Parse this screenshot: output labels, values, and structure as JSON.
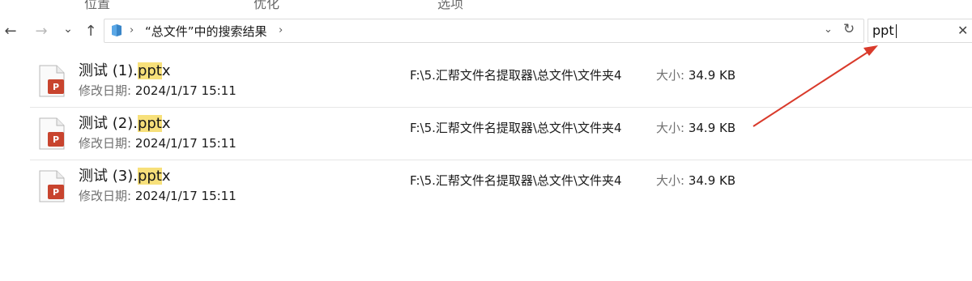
{
  "ribbon": {
    "tabs": [
      "位置",
      "优化",
      "选项"
    ]
  },
  "nav": {
    "back_icon": "←",
    "forward_icon": "→",
    "recent_icon": "⌄",
    "up_icon": "↑"
  },
  "address": {
    "separator": "›",
    "breadcrumb": "“总文件”中的搜索结果",
    "dropdown_icon": "⌄",
    "refresh_icon": "↻"
  },
  "search": {
    "value": "ppt",
    "clear_icon": "✕"
  },
  "colors": {
    "highlight": "#f7e07a",
    "annotation_arrow": "#d93a2b",
    "ppt_red": "#c8442e"
  },
  "results": [
    {
      "name_prefix": "测试 (1).",
      "name_match": "ppt",
      "name_suffix": "x",
      "modified_label": "修改日期:",
      "modified_value": "2024/1/17 15:11",
      "path": "F:\\5.汇帮文件名提取器\\总文件\\文件夹4",
      "size_label": "大小:",
      "size_value": "34.9 KB"
    },
    {
      "name_prefix": "测试 (2).",
      "name_match": "ppt",
      "name_suffix": "x",
      "modified_label": "修改日期:",
      "modified_value": "2024/1/17 15:11",
      "path": "F:\\5.汇帮文件名提取器\\总文件\\文件夹4",
      "size_label": "大小:",
      "size_value": "34.9 KB"
    },
    {
      "name_prefix": "测试 (3).",
      "name_match": "ppt",
      "name_suffix": "x",
      "modified_label": "修改日期:",
      "modified_value": "2024/1/17 15:11",
      "path": "F:\\5.汇帮文件名提取器\\总文件\\文件夹4",
      "size_label": "大小:",
      "size_value": "34.9 KB"
    }
  ]
}
